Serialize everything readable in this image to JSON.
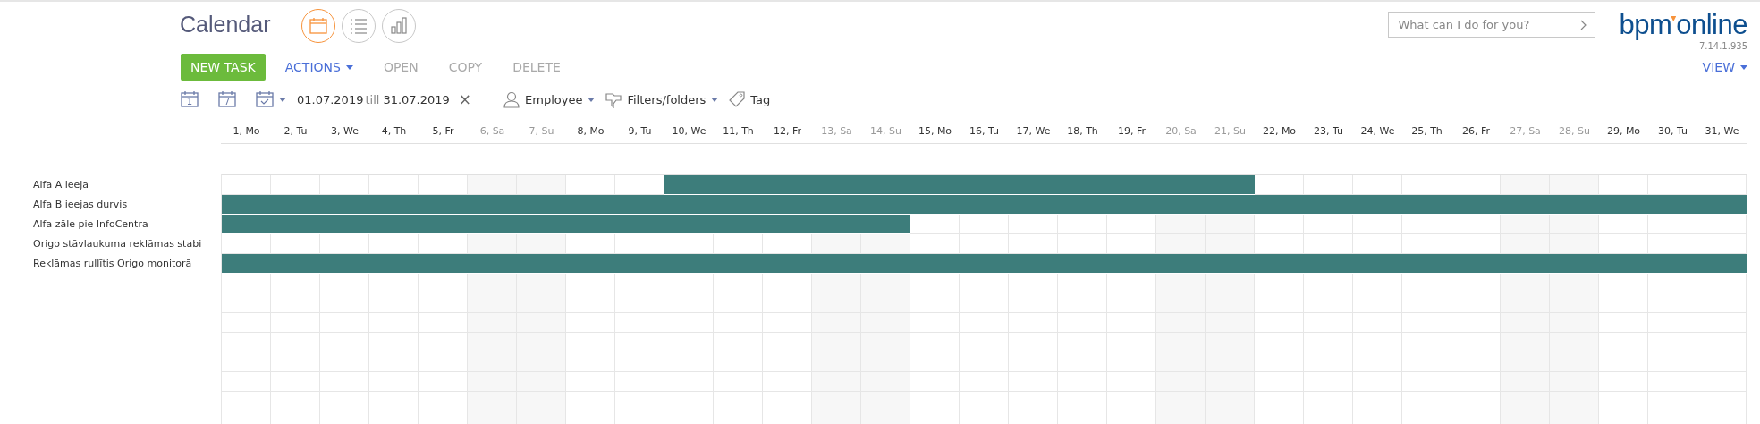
{
  "header": {
    "title": "Calendar",
    "views": [
      {
        "kind": "calendar",
        "selected": true
      },
      {
        "kind": "list",
        "selected": false
      },
      {
        "kind": "chart",
        "selected": false
      }
    ],
    "search": {
      "placeholder": "What can I do for you?"
    },
    "logo": {
      "left": "bpm",
      "right": "online"
    },
    "version": "7.14.1.935"
  },
  "toolbar": {
    "buttons": [
      {
        "label": "NEW TASK",
        "kind": "primary",
        "disabled": false
      },
      {
        "label": "ACTIONS",
        "kind": "menu",
        "disabled": false
      },
      {
        "label": "OPEN",
        "kind": "plain",
        "disabled": true
      },
      {
        "label": "COPY",
        "kind": "plain",
        "disabled": true
      },
      {
        "label": "DELETE",
        "kind": "plain",
        "disabled": true
      }
    ],
    "view_button": "VIEW"
  },
  "filters": {
    "day_button": "1",
    "week_button": "7",
    "date_from": "01.07.2019",
    "till": "till",
    "date_to": "31.07.2019",
    "clear": "×",
    "items": [
      {
        "label": "Employee",
        "kind": "person"
      },
      {
        "label": "Filters/folders",
        "kind": "folder"
      },
      {
        "label": "Tag",
        "kind": "tag"
      }
    ]
  },
  "timeline": {
    "days": [
      {
        "label": "1, Mo",
        "weekend": false
      },
      {
        "label": "2, Tu",
        "weekend": false
      },
      {
        "label": "3, We",
        "weekend": false
      },
      {
        "label": "4, Th",
        "weekend": false
      },
      {
        "label": "5, Fr",
        "weekend": false
      },
      {
        "label": "6, Sa",
        "weekend": true
      },
      {
        "label": "7, Su",
        "weekend": true
      },
      {
        "label": "8, Mo",
        "weekend": false
      },
      {
        "label": "9, Tu",
        "weekend": false
      },
      {
        "label": "10, We",
        "weekend": false
      },
      {
        "label": "11, Th",
        "weekend": false
      },
      {
        "label": "12, Fr",
        "weekend": false
      },
      {
        "label": "13, Sa",
        "weekend": true
      },
      {
        "label": "14, Su",
        "weekend": true
      },
      {
        "label": "15, Mo",
        "weekend": false
      },
      {
        "label": "16, Tu",
        "weekend": false
      },
      {
        "label": "17, We",
        "weekend": false
      },
      {
        "label": "18, Th",
        "weekend": false
      },
      {
        "label": "19, Fr",
        "weekend": false
      },
      {
        "label": "20, Sa",
        "weekend": true
      },
      {
        "label": "21, Su",
        "weekend": true
      },
      {
        "label": "22, Mo",
        "weekend": false
      },
      {
        "label": "23, Tu",
        "weekend": false
      },
      {
        "label": "24, We",
        "weekend": false
      },
      {
        "label": "25, Th",
        "weekend": false
      },
      {
        "label": "26, Fr",
        "weekend": false
      },
      {
        "label": "27, Sa",
        "weekend": true
      },
      {
        "label": "28, Su",
        "weekend": true
      },
      {
        "label": "29, Mo",
        "weekend": false
      },
      {
        "label": "30, Tu",
        "weekend": false
      },
      {
        "label": "31, We",
        "weekend": false
      }
    ],
    "rows": [
      {
        "label": "Alfa A ieeja",
        "booked": [
          false,
          false,
          false,
          false,
          false,
          false,
          false,
          false,
          false,
          true,
          true,
          true,
          true,
          true,
          true,
          true,
          true,
          true,
          true,
          true,
          true,
          false,
          false,
          false,
          false,
          false,
          false,
          false,
          false,
          false,
          false
        ]
      },
      {
        "label": "Alfa B ieejas durvis",
        "booked": [
          true,
          true,
          true,
          true,
          true,
          true,
          true,
          true,
          true,
          true,
          true,
          true,
          true,
          true,
          true,
          true,
          true,
          true,
          true,
          true,
          true,
          true,
          true,
          true,
          true,
          true,
          true,
          true,
          true,
          true,
          true
        ]
      },
      {
        "label": "Alfa zāle pie InfoCentra",
        "booked": [
          true,
          true,
          true,
          true,
          true,
          true,
          true,
          true,
          true,
          true,
          true,
          true,
          true,
          true,
          false,
          false,
          false,
          false,
          false,
          false,
          false,
          false,
          false,
          false,
          false,
          false,
          false,
          false,
          false,
          false,
          false
        ]
      },
      {
        "label": "Origo stāvlaukuma reklāmas stabi",
        "booked": [
          false,
          false,
          false,
          false,
          false,
          false,
          false,
          false,
          false,
          false,
          false,
          false,
          false,
          false,
          false,
          false,
          false,
          false,
          false,
          false,
          false,
          false,
          false,
          false,
          false,
          false,
          false,
          false,
          false,
          false,
          false
        ]
      },
      {
        "label": "Reklāmas rullītis Origo monitorā",
        "booked": [
          true,
          true,
          true,
          true,
          true,
          true,
          true,
          true,
          true,
          true,
          true,
          true,
          true,
          true,
          true,
          true,
          true,
          true,
          true,
          true,
          true,
          true,
          true,
          true,
          true,
          true,
          true,
          true,
          true,
          true,
          true
        ]
      }
    ]
  }
}
